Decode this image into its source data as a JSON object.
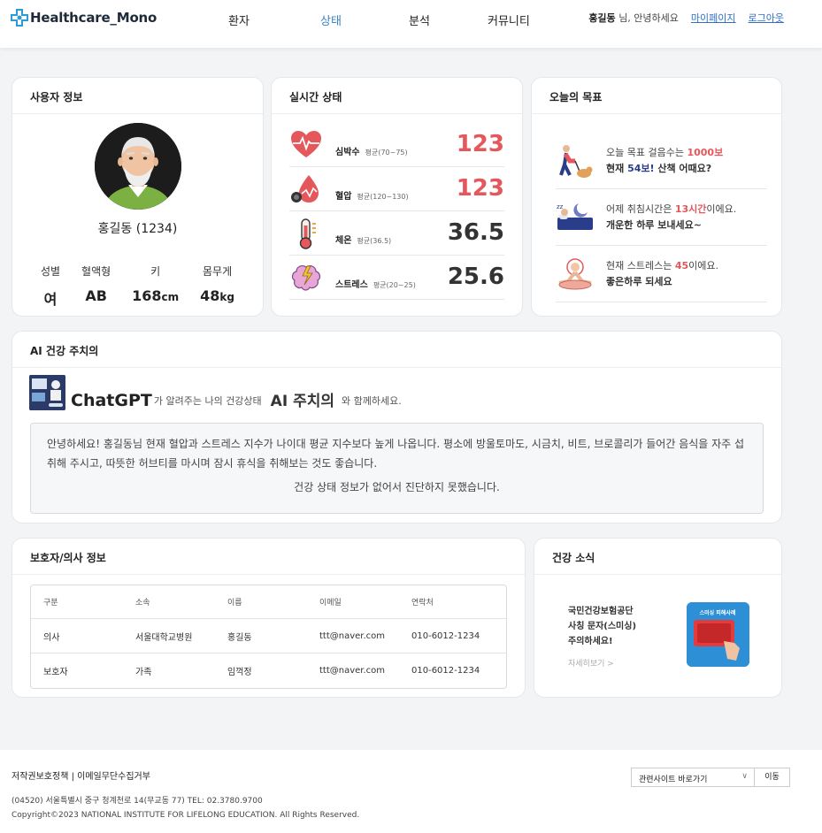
{
  "header": {
    "brand": "Healthcare_Mono",
    "nav": [
      "환자",
      "상태",
      "분석",
      "커뮤니티"
    ],
    "user_name": "홍길동",
    "greeting": "님, 안녕하세요",
    "mypage": "마이페이지",
    "logout": "로그아웃"
  },
  "user_info": {
    "title": "사용자 정보",
    "name": "홍길동 (1234)",
    "stats": [
      {
        "label": "성별",
        "value": "여",
        "unit": ""
      },
      {
        "label": "혈액형",
        "value": "AB",
        "unit": ""
      },
      {
        "label": "키",
        "value": "168",
        "unit": "cm"
      },
      {
        "label": "몸무게",
        "value": "48",
        "unit": "kg"
      }
    ]
  },
  "realtime": {
    "title": "실시간 상태",
    "rows": [
      {
        "name": "심박수",
        "avg": "평균(70~75)",
        "value": "123",
        "icon": "heart-icon"
      },
      {
        "name": "혈압",
        "avg": "평균(120~130)",
        "value": "123",
        "icon": "blood-pressure-icon"
      },
      {
        "name": "체온",
        "avg": "평균(36.5)",
        "value": "36.5",
        "icon": "thermometer-icon"
      },
      {
        "name": "스트레스",
        "avg": "평균(20~25)",
        "value": "25.6",
        "icon": "stress-brain-icon"
      }
    ]
  },
  "goals": {
    "title": "오늘의 목표",
    "items": [
      {
        "l1a": "오늘 목표 걸음수는 ",
        "l1h": "1000보",
        "l1b": "",
        "l2a": "현재 ",
        "l2h": "54보!",
        "l2b": " 산책 어때요?",
        "icon": "walking-icon"
      },
      {
        "l1a": "어제 취침시간은 ",
        "l1h": "13시간",
        "l1b": "이에요.",
        "l2a": "개운한 하루 보내세요~",
        "l2h": "",
        "l2b": "",
        "icon": "sleep-icon"
      },
      {
        "l1a": "현재 스트레스는 ",
        "l1h": "45",
        "l1b": "이에요.",
        "l2a": "좋은하루 되세요",
        "l2h": "",
        "l2b": "",
        "icon": "meditation-icon"
      }
    ]
  },
  "ai": {
    "title": "AI 건강 주치의",
    "gpt": "ChatGPT",
    "t1": "가 알려주는 나의 건강상태",
    "big": "AI 주치의",
    "t2": "와 함께하세요.",
    "message": "안녕하세요! 홍길동님 현재 혈압과 스트레스 지수가 나이대 평균 지수보다 높게 나옵니다. 평소에 방울토마도, 시금치, 비트, 브로콜리가 들어간 음식을 자주 섭취해 주시고, 따뜻한 허브티를 마시며 잠시 휴식을 취해보는 것도 좋습니다.",
    "notice": "건강 상태 정보가 없어서 진단하지 못했습니다."
  },
  "guardian": {
    "title": "보호자/의사 정보",
    "columns": [
      "구분",
      "소속",
      "이름",
      "이메일",
      "연락처"
    ],
    "rows": [
      [
        "의사",
        "서울대학교병원",
        "홍길동",
        "ttt@naver.com",
        "010-6012-1234"
      ],
      [
        "보호자",
        "가족",
        "임꺽정",
        "ttt@naver.com",
        "010-6012-1234"
      ]
    ]
  },
  "news": {
    "title": "건강 소식",
    "l1": "국민건강보험공단",
    "l2": "사칭 문자(스미싱)",
    "l3": "주의하세요!",
    "more": "자세히보기  >",
    "image_text": "스미싱 피해사례"
  },
  "footer": {
    "links": "저작권보호정책 | 이메일무단수집거부",
    "address": "(04520) 서울특별시 중구 청계천로 14(무교동 77) TEL: 02.3780.9700",
    "copyright": "Copyright©2023 NATIONAL INSTITUTE FOR LIFELONG EDUCATION. All Rights Reserved.",
    "select": "관련사이트 바로가기",
    "go": "이동"
  },
  "colors": {
    "accent": "#3b82c4",
    "alert": "#e4585c",
    "navy": "#2a3d8a"
  }
}
